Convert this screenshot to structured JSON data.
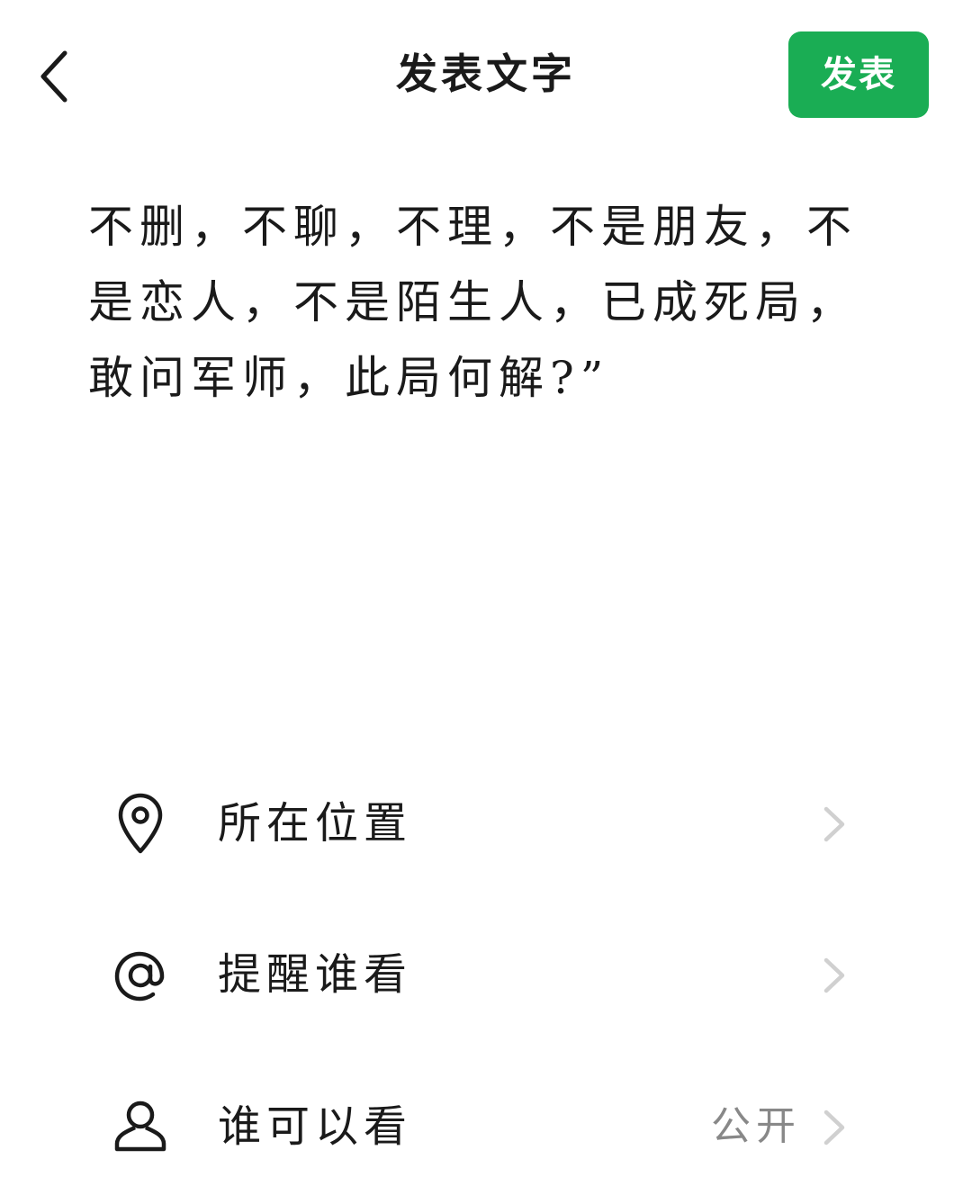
{
  "header": {
    "title": "发表文字",
    "publish_label": "发表",
    "back_icon": "chevron-left-icon"
  },
  "post": {
    "text": "不删，不聊，不理，不是朋友，不是恋人，不是陌生人，已成死局，敢问军师，此局何解?”"
  },
  "options": [
    {
      "icon": "location-pin-icon",
      "label": "所在位置",
      "value": ""
    },
    {
      "icon": "at-sign-icon",
      "label": "提醒谁看",
      "value": ""
    },
    {
      "icon": "person-icon",
      "label": "谁可以看",
      "value": "公开"
    }
  ],
  "colors": {
    "accent": "#1aad54",
    "text": "#1a1a1a",
    "secondary_text": "#888888",
    "chevron": "#d0d0d0"
  }
}
